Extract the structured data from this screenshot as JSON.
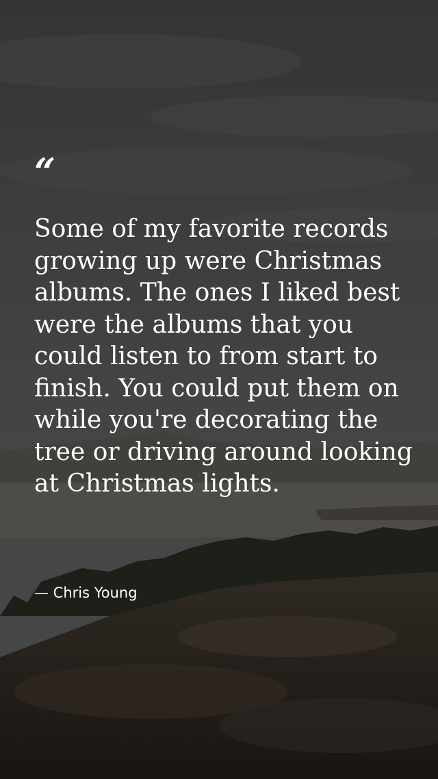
{
  "quote": {
    "mark": "“",
    "text": "Some of my favorite records growing up were Christmas albums. The ones I liked best were the albums that you could listen to from start to finish. You could put them on while you're decorating the tree or driving around looking at Christmas lights.",
    "author": "— Chris Young"
  },
  "colors": {
    "text": "#ffffff",
    "sky": "#4a4b4b",
    "ground": "#3a3027"
  }
}
